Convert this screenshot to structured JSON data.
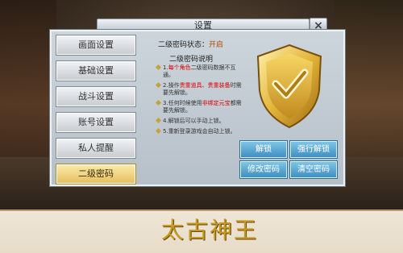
{
  "window": {
    "title": "设置",
    "close_label": "×"
  },
  "sidebar": {
    "items": [
      {
        "label": "画面设置",
        "active": false
      },
      {
        "label": "基础设置",
        "active": false
      },
      {
        "label": "战斗设置",
        "active": false
      },
      {
        "label": "账号设置",
        "active": false
      },
      {
        "label": "私人提醒",
        "active": false
      },
      {
        "label": "二级密码",
        "active": true
      }
    ]
  },
  "panel": {
    "status_label": "二级密码状态：",
    "status_value": "开启",
    "section_title": "二级密码说明",
    "notes": [
      {
        "num": "1.",
        "pre": "",
        "hl": "每个角色",
        "post": "二级密码数据不互通。"
      },
      {
        "num": "2.",
        "pre": "操作",
        "hl": "贵重道具、贵重装备",
        "post": "时需要先解锁。"
      },
      {
        "num": "3.",
        "pre": "任何时候使用",
        "hl": "非绑定元宝",
        "post": "都需要先解锁。"
      },
      {
        "num": "4.",
        "pre": "解锁后可以手动上锁。",
        "hl": "",
        "post": ""
      },
      {
        "num": "5.",
        "pre": "重新登录游戏会自动上锁。",
        "hl": "",
        "post": ""
      }
    ],
    "buttons": {
      "unlock": "解锁",
      "force_unlock": "强行解锁",
      "change_password": "修改密码",
      "clear_password": "清空密码"
    }
  },
  "footer": {
    "logo": "太古神王"
  },
  "colors": {
    "accent_gold": "#e4c061",
    "button_blue": "#3f8fc2",
    "highlight_red": "#dd0000"
  },
  "icons": {
    "shield": "shield-check-icon"
  }
}
